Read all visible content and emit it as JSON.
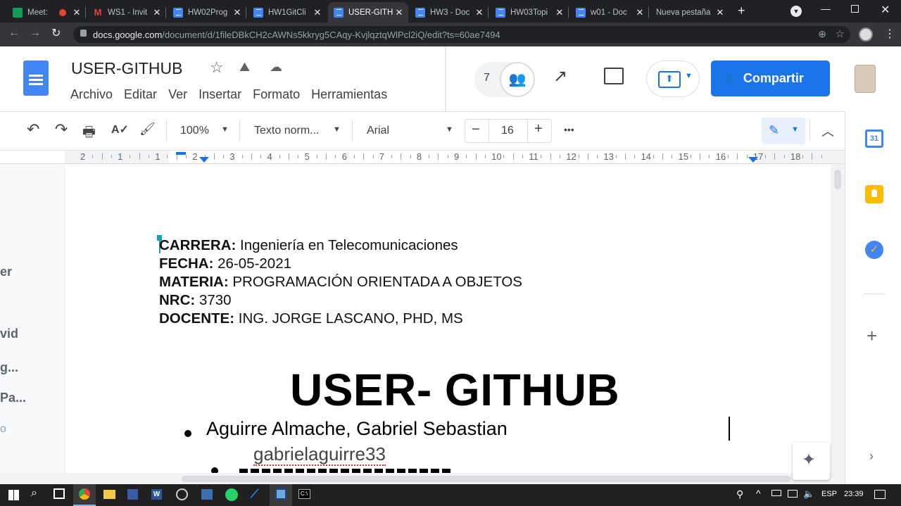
{
  "browser": {
    "tabs": [
      {
        "label": "Meet:",
        "icon": "meet-icon",
        "active": false
      },
      {
        "label": "WS1 - Invit",
        "icon": "gmail-icon",
        "active": false
      },
      {
        "label": "HW02Prog",
        "icon": "docs-icon",
        "active": false
      },
      {
        "label": "HW1GitCli",
        "icon": "docs-icon",
        "active": false
      },
      {
        "label": "USER-GITH",
        "icon": "docs-icon",
        "active": true
      },
      {
        "label": "HW3 - Doc",
        "icon": "docs-icon",
        "active": false
      },
      {
        "label": "HW03Topi",
        "icon": "docs-icon",
        "active": false
      },
      {
        "label": "w01 - Doc",
        "icon": "docs-icon",
        "active": false
      },
      {
        "label": "Nueva pestaña",
        "icon": "",
        "active": false
      }
    ],
    "url_host": "docs.google.com",
    "url_path": "/document/d/1fileDBkCH2cAWNs5kkryg5CAqy-KvjlqztqWlPcl2iQ/edit?ts=60ae7494"
  },
  "doc": {
    "title": "USER-GITHUB",
    "menu": [
      "Archivo",
      "Editar",
      "Ver",
      "Insertar",
      "Formato",
      "Herramientas"
    ],
    "viewer_count": "7",
    "share_label": "Compartir"
  },
  "toolbar": {
    "zoom": "100%",
    "style": "Texto norm...",
    "font": "Arial",
    "font_size": "16",
    "minus": "−",
    "plus": "+",
    "more": "•••"
  },
  "ruler": {
    "marks": [
      "2",
      "1",
      "1",
      "2",
      "3",
      "4",
      "5",
      "6",
      "7",
      "8",
      "9",
      "10",
      "11",
      "12",
      "13",
      "14",
      "15",
      "16",
      "17",
      "18"
    ]
  },
  "left_outline": [
    "er",
    "vid",
    "g...",
    "Pa...",
    "o"
  ],
  "content": {
    "meta": [
      {
        "label": "CARRERA:",
        "value": " Ingeniería en Telecomunicaciones"
      },
      {
        "label": "FECHA:",
        "value": " 26-05-2021"
      },
      {
        "label": "MATERIA:",
        "value": " PROGRAMACIÓN ORIENTADA A OBJETOS"
      },
      {
        "label": "NRC:",
        "value": " 3730"
      },
      {
        "label": "DOCENTE:",
        "value": " ING. JORGE LASCANO, PHD, MS"
      }
    ],
    "heading": "USER- GITHUB",
    "bullet_name": "Aguirre Almache, Gabriel Sebastian",
    "username": "gabrielaguirre33"
  },
  "taskbar": {
    "lang": "ESP",
    "time": "23:39"
  },
  "colors": {
    "accent": "#1a73e8",
    "tab_bg": "#202124",
    "active_tab": "#35363a"
  }
}
